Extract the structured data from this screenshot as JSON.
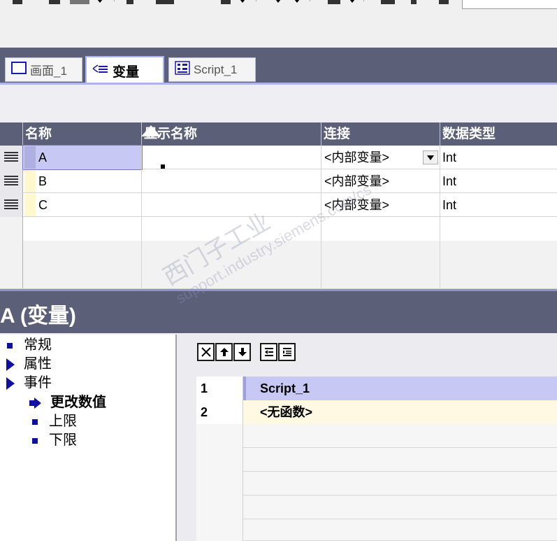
{
  "tabs": [
    {
      "label": "画面_1",
      "active": false
    },
    {
      "label": "变量",
      "active": true
    },
    {
      "label": "Script_1",
      "active": false
    }
  ],
  "table": {
    "headers": {
      "name": "名称",
      "display": "显示名称",
      "connection": "连接",
      "datatype": "数据类型"
    },
    "rows": [
      {
        "name": "A",
        "display": "",
        "connection": "<内部变量>",
        "datatype": "Int"
      },
      {
        "name": "B",
        "display": "",
        "connection": "<内部变量>",
        "datatype": "Int"
      },
      {
        "name": "C",
        "display": "",
        "connection": "<内部变量>",
        "datatype": "Int"
      }
    ]
  },
  "inspector": {
    "title": "A (变量)",
    "tree": [
      {
        "label": "常规",
        "icon": "square-bullet-icon"
      },
      {
        "label": "属性",
        "icon": "triangle-expand-icon"
      },
      {
        "label": "事件",
        "icon": "triangle-expand-icon"
      },
      {
        "label": "更改数值",
        "icon": "arrow-bullet-icon"
      },
      {
        "label": "上限",
        "icon": "square-bullet-icon"
      },
      {
        "label": "下限",
        "icon": "square-bullet-icon"
      }
    ],
    "events": [
      {
        "num": "1",
        "value": "Script_1"
      },
      {
        "num": "2",
        "value": "<无函数>"
      }
    ]
  },
  "watermark": {
    "line1": "西门子工业",
    "line2": "support.industry.siemens.com/cs"
  },
  "colors": {
    "header_bg": "#5b5f78",
    "selection": "#c8c8f4",
    "tab_accent": "#aeb4f0",
    "bullet": "#1010a0"
  }
}
